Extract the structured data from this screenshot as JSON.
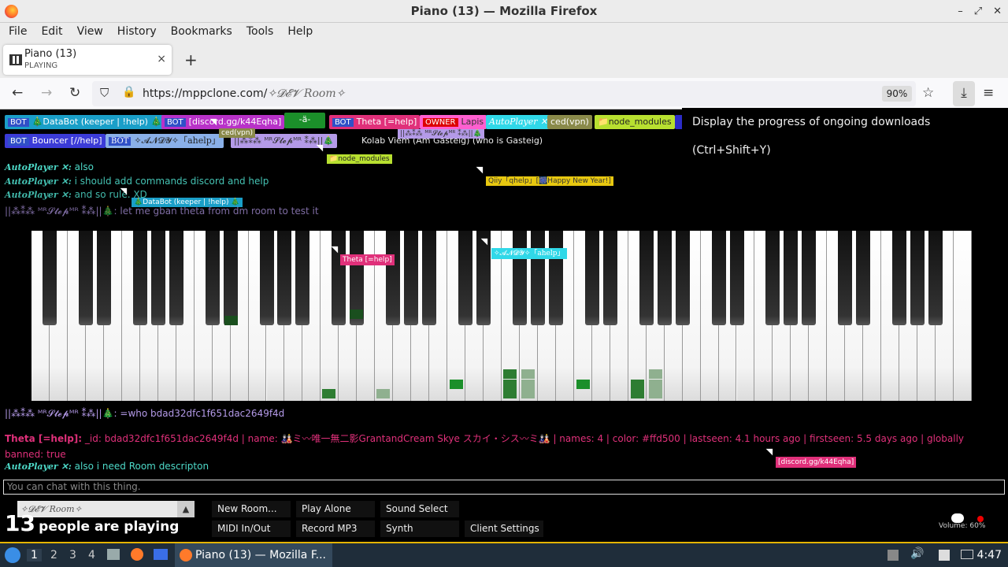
{
  "window": {
    "title": "Piano (13) — Mozilla Firefox"
  },
  "menu": [
    "File",
    "Edit",
    "View",
    "History",
    "Bookmarks",
    "Tools",
    "Help"
  ],
  "tab": {
    "title": "Piano (13)",
    "subtitle": "PLAYING",
    "close": "×",
    "new": "+"
  },
  "nav": {
    "url_host": "https://mppclone.com/",
    "url_path": "✧𝓓𝓔𝓥 Room✧",
    "zoom": "90%"
  },
  "tooltip": "Display the progress of ongoing downloads (Ctrl+Shift+Y)",
  "users": {
    "u1_tag": "BOT",
    "u1": "🎄DataBot (keeper | !help) 🎄",
    "u2_tag": "BOT",
    "u2": "[discord.gg/k44Eqha]",
    "u3": "-ä-",
    "u4_tag": "BOT",
    "u4": "Theta [=help]",
    "u5_tag": "OWNER",
    "u5": "Lapis",
    "u6": "AutoPlayer ✕",
    "u7": "ced(vpn)",
    "u8": "📁node_modules",
    "u9_tag": "BOT",
    "u9": "Bouncer [//help]",
    "u10_tag": "BOT",
    "u10": "✧𝓐𝓝𝓓𝓨✧「ahelp」",
    "u11": "||⁂⁑⁂ ᴹᴿ𝓢𝓽𝓮𝓹ᴹᴿ ⁑⁂||🎄",
    "u12": "Kolab Viem (Am Gasteig) (who is Gasteig)"
  },
  "floating_labels": {
    "f1": "ced(vpn)",
    "f2": "||⁂⁑⁂ ᴹᴿ𝓢𝓽𝓮𝓹ᴹᴿ ⁑⁂||🎄",
    "f3": "📁node_modules",
    "f4": "Qiiy「qhelp」[🎆Happy New Year!]",
    "f5": "🎄DataBot (keeper | !help) 🎄",
    "f6": "Theta [=help]",
    "f7": "✧𝓐𝓝𝓓𝓨✧「ahelp」",
    "f8": "[discord.gg/k44Eqha]"
  },
  "chat_top": [
    {
      "name": "AutoPlayer ✕:",
      "text": "also"
    },
    {
      "name": "AutoPlayer ✕:",
      "text": "i should add commands discord and help"
    },
    {
      "name": "AutoPlayer ✕:",
      "text": "and so rule. XD"
    },
    {
      "name": "||⁂⁑⁂ ᴹᴿ𝓢𝓽𝓮𝓹ᴹᴿ ⁑⁂||🎄:",
      "text": "let me gban theta from dm room to test it"
    }
  ],
  "chat_bottom": {
    "c1_name": "||⁂⁑⁂ ᴹᴿ𝓢𝓽𝓮𝓹ᴹᴿ ⁑⁂||🎄:",
    "c1_text": "=who bdad32dfc1f651dac2649f4d",
    "c2_name": "Theta [=help]:",
    "c2_text": "_id: bdad32dfc1f651dac2649f4d | name: 🎎ミ〰唯一無二影GrantandCream Skye スカイ・シス〰ミ🎎 | names: 4 | color: #ffd500 | lastseen: 4.1 hours ago | firstseen: 5.5 days ago | globally banned:",
    "c2_text2": "true",
    "c3_name": "AutoPlayer ✕:",
    "c3_text": "also i need Room descripton"
  },
  "chat_input_placeholder": "You can chat with this thing.",
  "controls": {
    "room": "✧𝓓𝓔𝓥 Room✧",
    "new_room": "New Room...",
    "play_alone": "Play Alone",
    "sound_select": "Sound Select",
    "midi": "MIDI In/Out",
    "record": "Record MP3",
    "synth": "Synth",
    "client_settings": "Client Settings",
    "players_count": "13",
    "players_label": "people are playing",
    "volume": "Volume: 60%"
  },
  "taskbar": {
    "ws1": "1",
    "ws2": "2",
    "ws3": "3",
    "ws4": "4",
    "app": "Piano (13) — Mozilla F...",
    "clock": "4:47"
  },
  "colors": {
    "accent_border": "#e5b400",
    "theta": "#e0307a",
    "autoplayer": "#4dd9c8",
    "lapis": "#ff5fd0"
  }
}
